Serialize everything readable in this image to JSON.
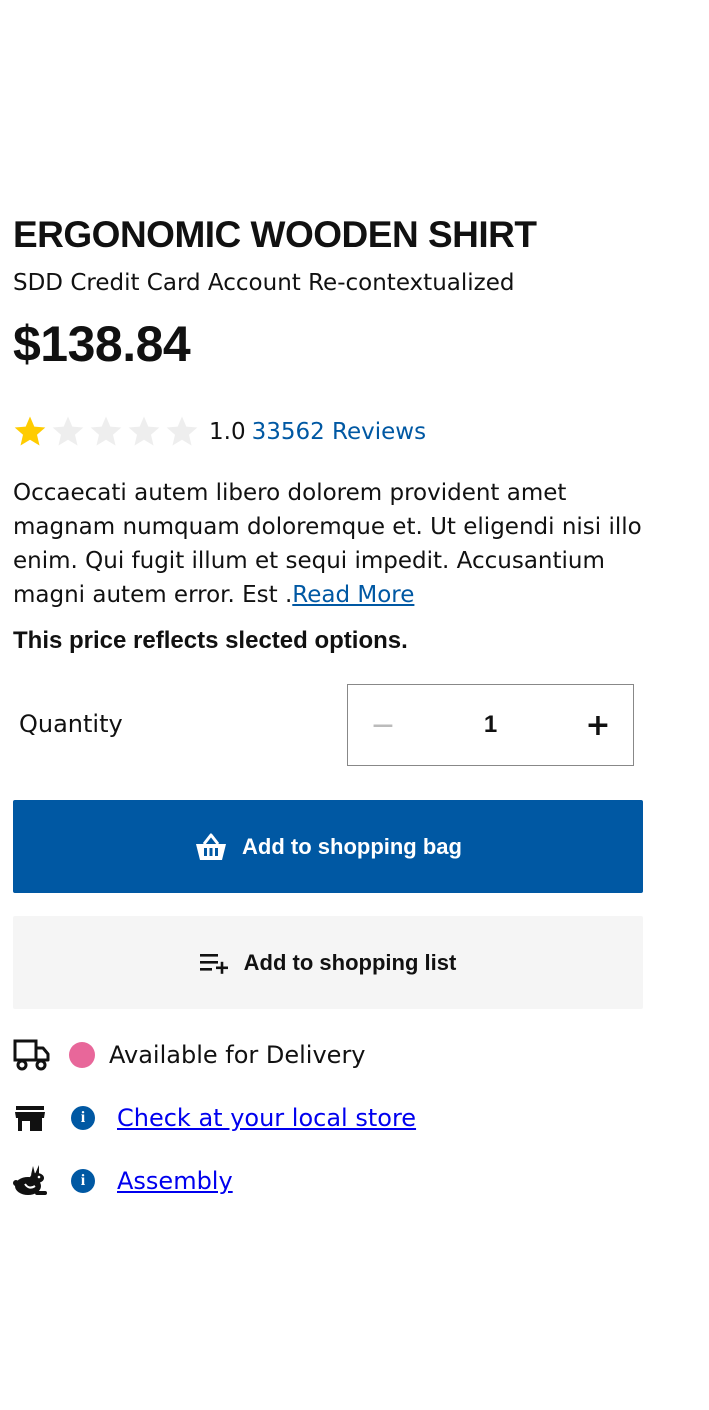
{
  "product": {
    "title": "ERGONOMIC WOODEN SHIRT",
    "subtitle": "SDD Credit Card Account Re-contextualized",
    "price": "$138.84",
    "rating": {
      "value_text": "1.0",
      "value": 1.0,
      "max": 5,
      "reviews_text": "33562 Reviews"
    },
    "description": "Occaecati autem libero dolorem provident amet magnam numquam doloremque et. Ut eligendi nisi illo enim. Qui fugit illum et sequi impedit. Accusantium magni autem error. Est .",
    "read_more": "Read More",
    "price_note": "This price reflects slected options."
  },
  "quantity": {
    "label": "Quantity",
    "value": "1",
    "minus": "−",
    "plus": "+"
  },
  "buttons": {
    "add_to_bag": "Add to shopping bag",
    "add_to_list": "Add to shopping list"
  },
  "availability": [
    {
      "icon": "truck-icon",
      "status_color": "#e8679a",
      "text": "Available for Delivery"
    },
    {
      "icon": "store-icon",
      "status_icon": "info-icon",
      "link": "Check at your local store"
    },
    {
      "icon": "rabbit-icon",
      "status_icon": "info-icon",
      "link": "Assembly"
    }
  ],
  "colors": {
    "brand_blue": "#0058a3",
    "star_filled": "#ffcc00",
    "star_empty": "#eeeeee",
    "delivery_dot": "#e8679a",
    "secondary_bg": "#f5f5f5"
  }
}
